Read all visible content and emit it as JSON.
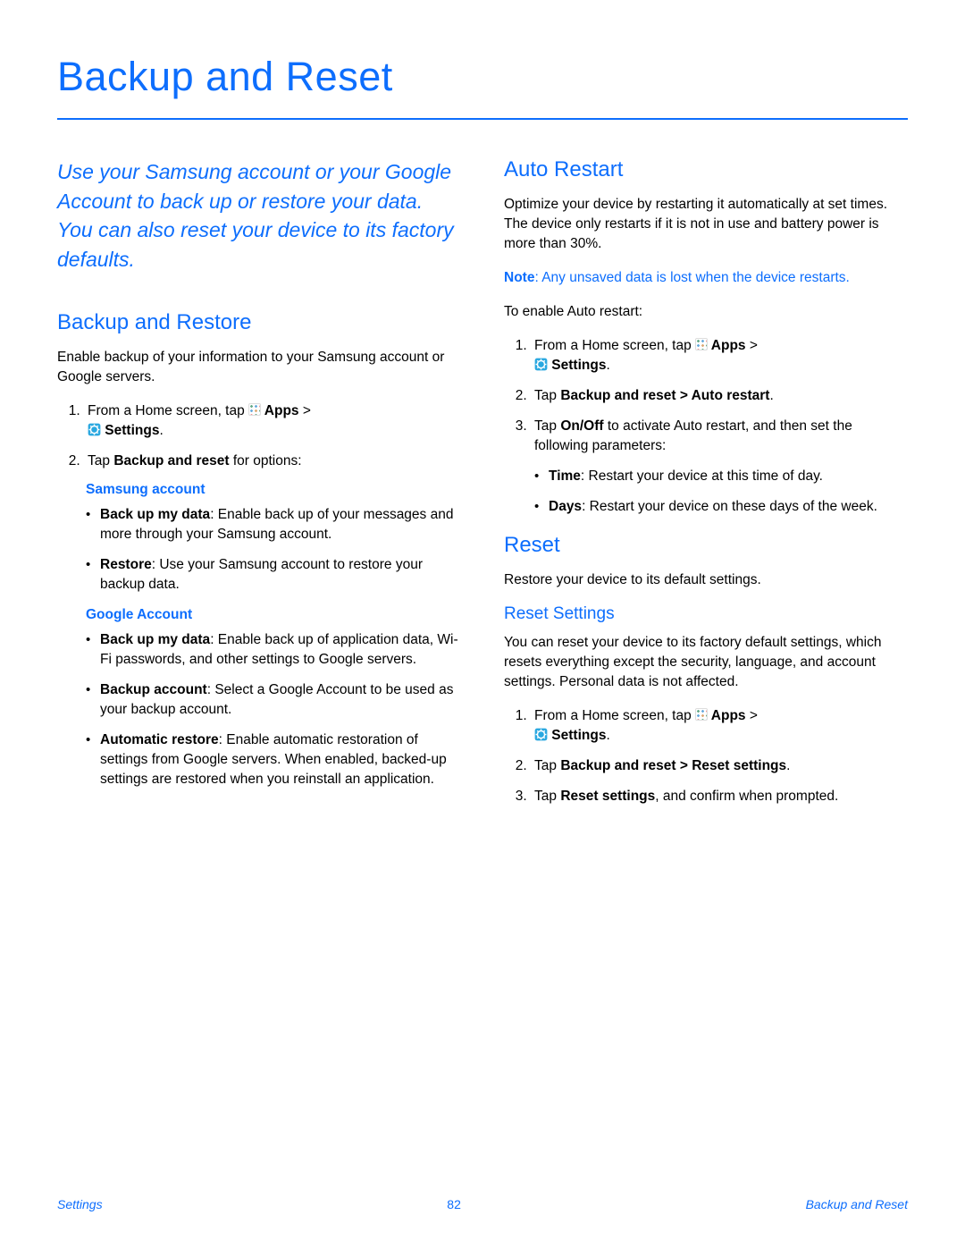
{
  "page": {
    "title": "Backup and Reset",
    "intro": "Use your Samsung account or your Google Account to back up or restore your data. You can also reset your device to its factory defaults."
  },
  "icons": {
    "apps_label": " Apps",
    "settings_label": " Settings"
  },
  "left": {
    "heading": "Backup and Restore",
    "body": "Enable backup of your information to your Samsung account or Google servers.",
    "step1_a": "From a Home screen, tap ",
    "step1_b": " > ",
    "step1_c": ".",
    "step2_a": "Tap ",
    "step2_b": "Backup and reset",
    "step2_c": " for options:",
    "samsung_label": "Samsung account",
    "samsung_b1_b": "Back up my data",
    "samsung_b1_t": ": Enable back up of your messages and more through your Samsung account.",
    "samsung_b2_b": "Restore",
    "samsung_b2_t": ": Use your Samsung account to restore your backup data.",
    "google_label": "Google Account",
    "google_b1_b": "Back up my data",
    "google_b1_t": ": Enable back up of application data, Wi-Fi passwords, and other settings to Google servers.",
    "google_b2_b": "Backup account",
    "google_b2_t": ": Select a Google Account to be used as your backup account.",
    "google_b3_b": "Automatic restore",
    "google_b3_t": ": Enable automatic restoration of settings from Google servers. When enabled, backed-up settings are restored when you reinstall an application."
  },
  "right": {
    "auto_heading": "Auto Restart",
    "auto_body": "Optimize your device by restarting it automatically at set times. The device only restarts if it is not in use and battery power is more than 30%.",
    "auto_note_b": "Note",
    "auto_note_t": ": Any unsaved data is lost when the device restarts.",
    "auto_enable": "To enable Auto restart:",
    "auto_s1_a": "From a Home screen, tap ",
    "auto_s1_b": " > ",
    "auto_s1_c": ".",
    "auto_s2_a": "Tap ",
    "auto_s2_b": "Backup and reset > Auto restart",
    "auto_s2_c": ".",
    "auto_s3_a": "Tap ",
    "auto_s3_b": "On/Off",
    "auto_s3_c": " to activate Auto restart, and then set the following parameters:",
    "auto_p1_b": "Time",
    "auto_p1_t": ": Restart your device at this time of day.",
    "auto_p2_b": "Days",
    "auto_p2_t": ": Restart your device on these days of the week.",
    "reset_heading": "Reset",
    "reset_body": "Restore your device to its default settings.",
    "rs_heading": "Reset Settings",
    "rs_body": "You can reset your device to its factory default settings, which resets everything except the security, language, and account settings. Personal data is not affected.",
    "rs_s1_a": "From a Home screen, tap ",
    "rs_s1_b": " > ",
    "rs_s1_c": ".",
    "rs_s2_a": "Tap ",
    "rs_s2_b": "Backup and reset > Reset settings",
    "rs_s2_c": ".",
    "rs_s3_a": "Tap ",
    "rs_s3_b": "Reset settings",
    "rs_s3_c": ", and confirm when prompted."
  },
  "footer": {
    "left": "Settings",
    "center": "82",
    "right": "Backup and Reset"
  }
}
